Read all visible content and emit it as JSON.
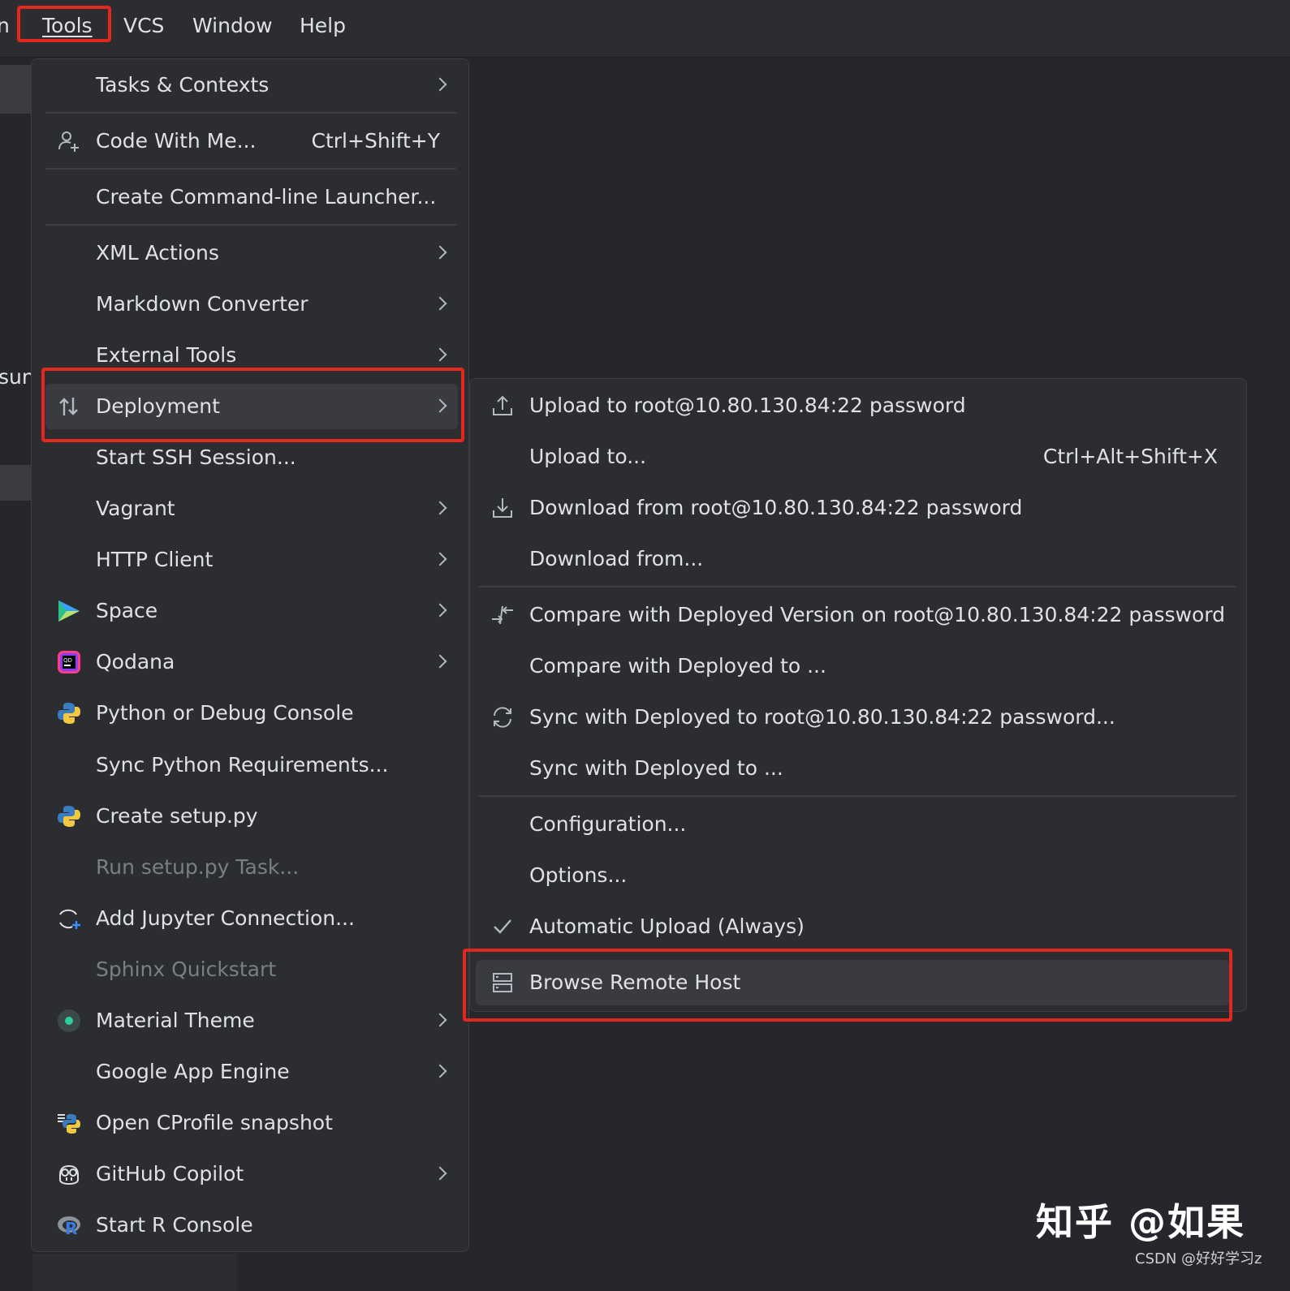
{
  "menubar": {
    "partial_left": "n",
    "items": [
      "Tools",
      "VCS",
      "Window",
      "Help"
    ]
  },
  "background": {
    "partial_text": "sun"
  },
  "tools_menu": {
    "items": [
      {
        "label": "Tasks & Contexts",
        "submenu": true
      },
      {
        "label": "Code With Me...",
        "shortcut": "Ctrl+Shift+Y",
        "icon": "user-add-icon"
      },
      {
        "label": "Create Command-line Launcher..."
      },
      {
        "label": "XML Actions",
        "submenu": true
      },
      {
        "label": "Markdown Converter",
        "submenu": true
      },
      {
        "label": "External Tools",
        "submenu": true
      },
      {
        "label": "Deployment",
        "submenu": true,
        "icon": "deployment-icon",
        "selected": true
      },
      {
        "label": "Start SSH Session..."
      },
      {
        "label": "Vagrant",
        "submenu": true
      },
      {
        "label": "HTTP Client",
        "submenu": true
      },
      {
        "label": "Space",
        "submenu": true,
        "icon": "space-logo-icon"
      },
      {
        "label": "Qodana",
        "submenu": true,
        "icon": "qodana-logo-icon"
      },
      {
        "label": "Python or Debug Console",
        "icon": "python-console-icon"
      },
      {
        "label": "Sync Python Requirements..."
      },
      {
        "label": "Create setup.py",
        "icon": "python-icon"
      },
      {
        "label": "Run setup.py Task...",
        "disabled": true
      },
      {
        "label": "Add Jupyter Connection...",
        "icon": "jupyter-add-icon"
      },
      {
        "label": "Sphinx Quickstart",
        "disabled": true
      },
      {
        "label": "Material Theme",
        "submenu": true,
        "icon": "material-theme-icon"
      },
      {
        "label": "Google App Engine",
        "submenu": true
      },
      {
        "label": "Open CProfile snapshot",
        "icon": "cprofile-icon"
      },
      {
        "label": "GitHub Copilot",
        "submenu": true,
        "icon": "copilot-icon"
      },
      {
        "label": "Start R Console",
        "icon": "r-console-icon"
      }
    ]
  },
  "deployment_menu": {
    "items": [
      {
        "label": "Upload to root@10.80.130.84:22 password",
        "icon": "upload-icon"
      },
      {
        "label": "Upload to...",
        "shortcut": "Ctrl+Alt+Shift+X"
      },
      {
        "label": "Download from root@10.80.130.84:22 password",
        "icon": "download-icon"
      },
      {
        "label": "Download from..."
      },
      {
        "label": "Compare with Deployed Version on root@10.80.130.84:22 password",
        "icon": "compare-icon"
      },
      {
        "label": "Compare with Deployed to ..."
      },
      {
        "label": "Sync with Deployed to root@10.80.130.84:22 password...",
        "icon": "sync-icon"
      },
      {
        "label": "Sync with Deployed to ..."
      },
      {
        "label": "Configuration..."
      },
      {
        "label": "Options..."
      },
      {
        "label": "Automatic Upload (Always)",
        "icon": "checkmark-icon"
      },
      {
        "label": "Browse Remote Host",
        "icon": "remote-host-icon",
        "selected": true
      }
    ]
  },
  "watermark": {
    "text": "知乎 @如果",
    "csdn": "CSDN @好好学习z"
  },
  "colors": {
    "highlight_box": "#e3271f",
    "menu_bg": "#2b2d30",
    "selected_bg": "#393b40",
    "text": "#dfe1e5",
    "disabled_text": "#7a7e85"
  }
}
